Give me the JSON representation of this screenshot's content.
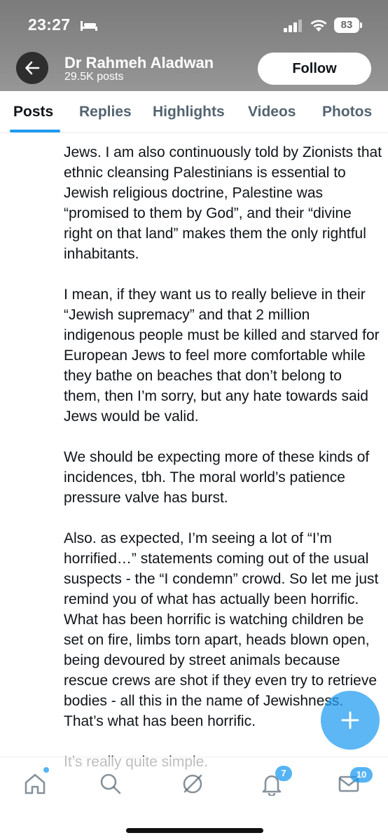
{
  "status_bar": {
    "time": "23:27",
    "battery": "83"
  },
  "header": {
    "name": "Dr Rahmeh Aladwan",
    "posts": "29.5K posts",
    "follow_label": "Follow"
  },
  "tabs": [
    {
      "label": "Posts",
      "active": true
    },
    {
      "label": "Replies",
      "active": false
    },
    {
      "label": "Highlights",
      "active": false
    },
    {
      "label": "Videos",
      "active": false
    },
    {
      "label": "Photos",
      "active": false
    }
  ],
  "post": {
    "paragraphs": [
      "Jews. I am also continuously told by Zionists that ethnic cleansing Palestinians is essential to Jewish religious doctrine, Palestine was “promised to them by God”, and their “divine right on that land” makes them the only rightful inhabitants.",
      "I mean, if they want us to really believe in their “Jewish supremacy” and that 2 million indigenous people must be killed and starved for European Jews to feel more comfortable while they bathe on beaches that don’t belong to them, then I’m sorry, but any hate towards said Jews would be valid.",
      "We should be expecting more of these kinds of incidences, tbh. The moral world’s patience pressure valve has burst.",
      "Also. as expected, I’m seeing a lot of “I’m horrified…” statements coming out of the usual suspects - the “I condemn” crowd. So let me just remind you of what has actually been horrific.",
      "What has been horrific is watching children be set on fire, limbs torn apart, heads blown open, being devoured by street animals because rescue crews are shot if they even try to retrieve bodies - all this in the name of Jewishness.",
      "That’s what has been horrific.",
      "It’s really quite simple."
    ]
  },
  "bottom_nav": {
    "notifications_count": "7",
    "messages_count": "10"
  },
  "colors": {
    "accent": "#1d9bf0",
    "text": "#0f1419",
    "muted": "#536471",
    "header_bg": "#888888"
  }
}
